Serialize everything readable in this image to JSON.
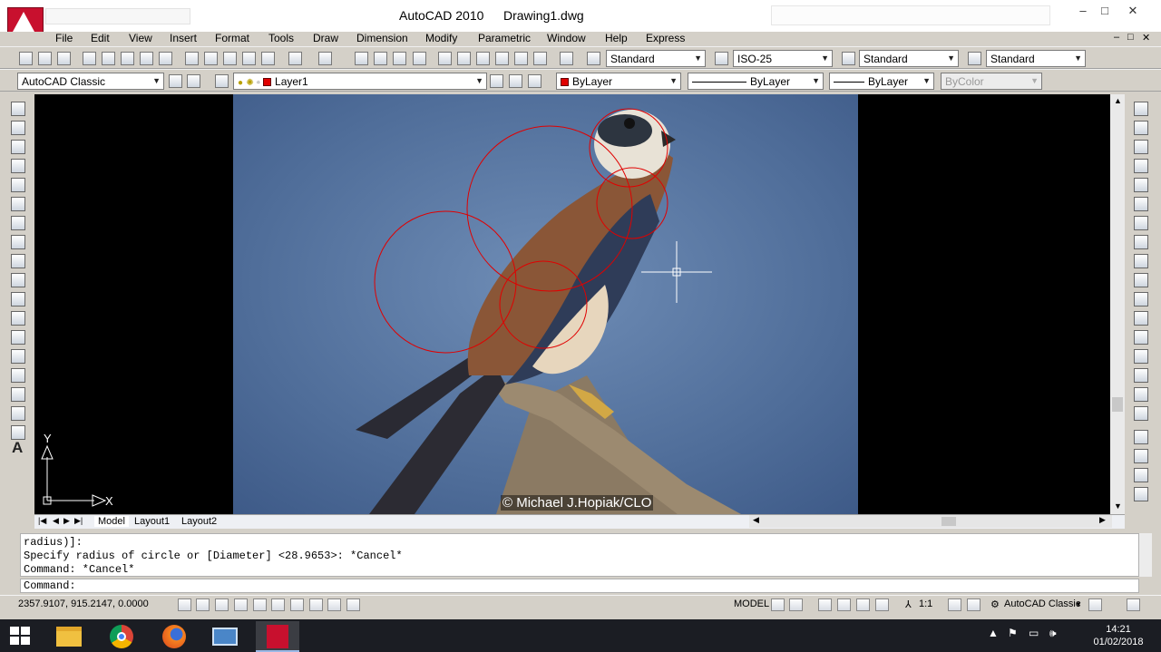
{
  "window": {
    "app_title": "AutoCAD 2010",
    "file_title": "Drawing1.dwg",
    "minimize": "–",
    "maximize": "□",
    "close": "✕"
  },
  "menu": {
    "items": [
      "File",
      "Edit",
      "View",
      "Insert",
      "Format",
      "Tools",
      "Draw",
      "Dimension",
      "Modify",
      "Parametric",
      "Window",
      "Help",
      "Express"
    ],
    "mdi_controls": [
      "–",
      "□",
      "✕"
    ]
  },
  "styles_toolbar": {
    "text_style": "Standard",
    "dim_style": "ISO-25",
    "table_style": "Standard",
    "multileader_style": "Standard"
  },
  "workspace": {
    "selected": "AutoCAD Classic"
  },
  "layers_toolbar": {
    "current_layer": "Layer1",
    "layer_color": "#e00000"
  },
  "properties_toolbar": {
    "color": "ByLayer",
    "linetype": "ByLayer",
    "lineweight": "ByLayer",
    "plot_style": "ByColor"
  },
  "canvas": {
    "photo_credit": "© Michael J.Hopiak/CLO",
    "ucs_x": "X",
    "ucs_y": "Y"
  },
  "layout_tabs": [
    "Model",
    "Layout1",
    "Layout2"
  ],
  "command_history": [
    "radius)]:",
    "Specify radius of circle or [Diameter] <28.9653>: *Cancel*",
    "Command: *Cancel*"
  ],
  "command_prompt": "Command:",
  "status": {
    "coordinates": "2357.9107, 915.2147, 0.0000",
    "space": "MODEL",
    "annotation_scale": "1:1",
    "workspace": "AutoCAD Classic"
  },
  "taskbar": {
    "time": "14:21",
    "date": "01/02/2018"
  }
}
